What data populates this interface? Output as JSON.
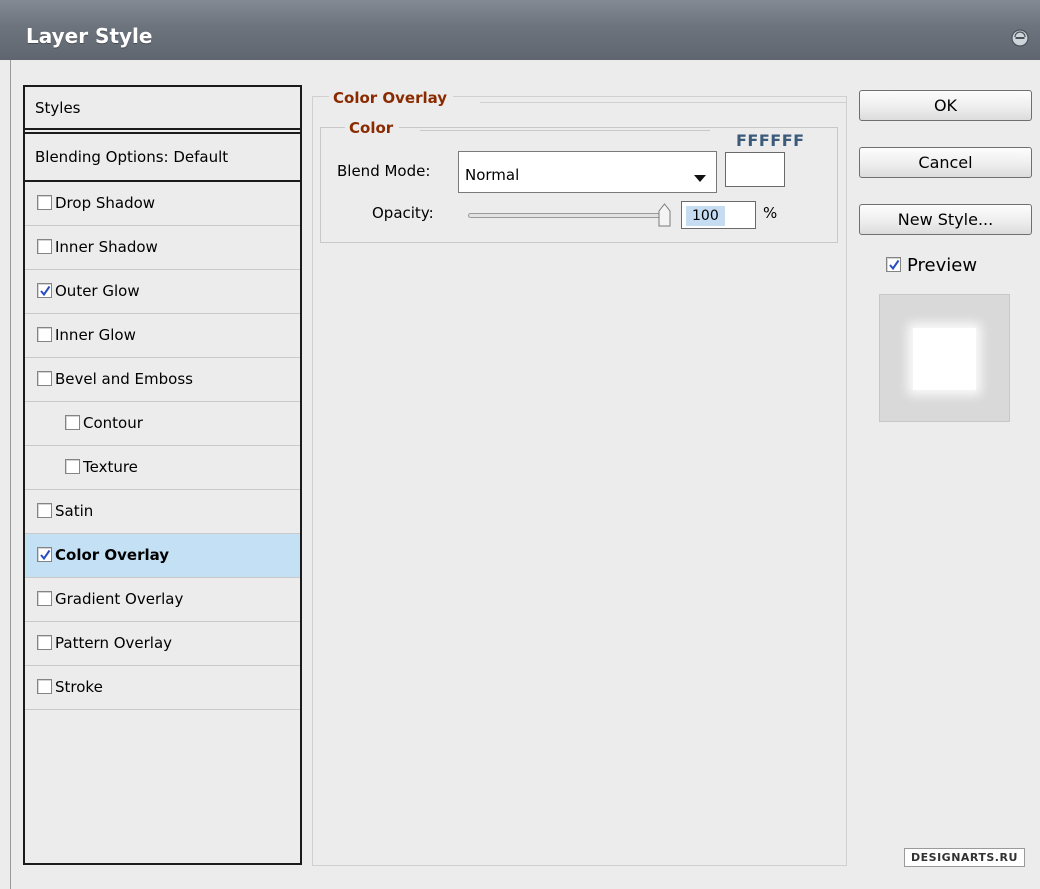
{
  "window": {
    "title": "Layer Style"
  },
  "styles_panel": {
    "header": "Styles",
    "blending_options": "Blending Options: Default",
    "items": [
      {
        "label": "Drop Shadow",
        "checked": false
      },
      {
        "label": "Inner Shadow",
        "checked": false
      },
      {
        "label": "Outer Glow",
        "checked": true
      },
      {
        "label": "Inner Glow",
        "checked": false
      },
      {
        "label": "Bevel and Emboss",
        "checked": false
      },
      {
        "label": "Contour",
        "checked": false
      },
      {
        "label": "Texture",
        "checked": false
      },
      {
        "label": "Satin",
        "checked": false
      },
      {
        "label": "Color Overlay",
        "checked": true,
        "selected": true
      },
      {
        "label": "Gradient Overlay",
        "checked": false
      },
      {
        "label": "Pattern Overlay",
        "checked": false
      },
      {
        "label": "Stroke",
        "checked": false
      }
    ]
  },
  "color_overlay": {
    "group_title": "Color Overlay",
    "subgroup_title": "Color",
    "blend_mode_label": "Blend Mode:",
    "blend_mode_value": "Normal",
    "color_hex": "FFFFFF",
    "color_value": "#ffffff",
    "opacity_label": "Opacity:",
    "opacity_value": "100",
    "opacity_unit": "%"
  },
  "buttons": {
    "ok": "OK",
    "cancel": "Cancel",
    "new_style": "New Style..."
  },
  "preview": {
    "label": "Preview",
    "checked": true
  },
  "watermark": "DESIGNARTS.RU",
  "colors": {
    "title_bar": "#6c737c",
    "group_title": "#8a2a00",
    "selected_row": "#c4e0f4",
    "dialog_bg": "#ececec"
  }
}
